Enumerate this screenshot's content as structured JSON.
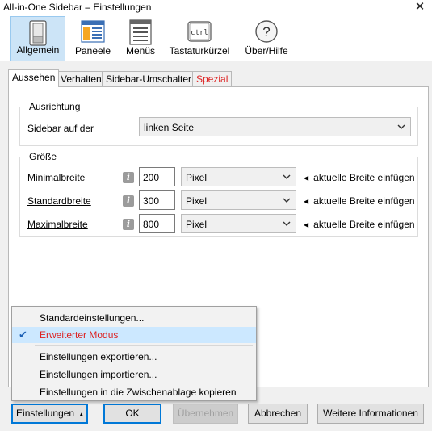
{
  "window": {
    "title": "All-in-One Sidebar – Einstellungen",
    "close_glyph": "✕"
  },
  "panes": [
    {
      "label": "Allgemein",
      "icon": "switch-icon",
      "active": true
    },
    {
      "label": "Paneele",
      "icon": "panels-icon",
      "active": false
    },
    {
      "label": "Menüs",
      "icon": "menus-icon",
      "active": false
    },
    {
      "label": "Tastaturkürzel",
      "icon": "keyboard-ctrl-icon",
      "icon_text": "ctrl",
      "active": false
    },
    {
      "label": "Über/Hilfe",
      "icon": "help-icon",
      "icon_text": "?",
      "active": false
    }
  ],
  "tabs": [
    {
      "label": "Aussehen",
      "selected": true
    },
    {
      "label": "Verhalten",
      "selected": false
    },
    {
      "label": "Sidebar-Umschalter",
      "selected": false
    },
    {
      "label": "Spezial",
      "selected": false,
      "color": "#d22222"
    }
  ],
  "ausrichtung": {
    "legend": "Ausrichtung",
    "label": "Sidebar auf der",
    "value": "linken Seite"
  },
  "groesse": {
    "legend": "Größe",
    "rows": [
      {
        "label_underline": "M",
        "label_rest": "inimalbreite",
        "value": "200",
        "unit": "Pixel",
        "insert": "aktuelle Breite einfügen"
      },
      {
        "label_underline": "S",
        "label_rest": "tandardbreite",
        "value": "300",
        "unit": "Pixel",
        "insert": "aktuelle Breite einfügen"
      },
      {
        "label_underline": "M",
        "label_rest": "aximalbreite",
        "value": "800",
        "unit": "Pixel",
        "insert": "aktuelle Breite einfügen"
      }
    ],
    "info_glyph": "i"
  },
  "menu": {
    "items": [
      {
        "label": "Standardeinstellungen...",
        "checked": false
      },
      {
        "label": "Erweiterter Modus",
        "checked": true,
        "color": "#d22222"
      },
      {
        "label": "Einstellungen exportieren...",
        "checked": false
      },
      {
        "label": "Einstellungen importieren...",
        "checked": false
      },
      {
        "label": "Einstellungen in die Zwischenablage kopieren",
        "checked": false
      }
    ],
    "check_glyph": "✔"
  },
  "buttons": {
    "settings": "Einstellungen",
    "settings_arrow": "▴",
    "ok": "OK",
    "apply": "Übernehmen",
    "cancel": "Abbrechen",
    "more_info": "Weitere Informationen"
  },
  "colors": {
    "accent": "#0078d7",
    "selected_pane": "#cce4f7",
    "warning_red": "#d22222"
  }
}
